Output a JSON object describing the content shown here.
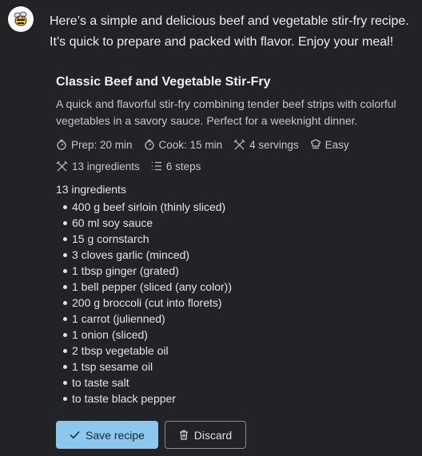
{
  "message": {
    "intro": "Here’s a simple and delicious beef and vegetable stir-fry recipe. It’s quick to prepare and packed with flavor. Enjoy your meal!"
  },
  "recipe": {
    "title": "Classic Beef and Vegetable Stir-Fry",
    "description": "A quick and flavorful stir-fry combining tender beef strips with colorful vegetables in a savory sauce. Perfect for a weeknight dinner.",
    "meta": {
      "prep": "Prep: 20 min",
      "cook": "Cook: 15 min",
      "servings": "4 servings",
      "difficulty": "Easy",
      "ingredients_count": "13 ingredients",
      "steps_count": "6 steps"
    },
    "ingredients_heading": "13 ingredients",
    "ingredients": [
      "400 g beef sirloin (thinly sliced)",
      "60 ml soy sauce",
      "15 g cornstarch",
      "3 cloves garlic (minced)",
      "1 tbsp ginger (grated)",
      "1 bell pepper (sliced (any color))",
      "200 g broccoli (cut into florets)",
      "1 carrot (julienned)",
      "1 onion (sliced)",
      "2 tbsp vegetable oil",
      "1 tsp sesame oil",
      "to taste salt",
      "to taste black pepper"
    ]
  },
  "actions": {
    "save_label": "Save recipe",
    "discard_label": "Discard"
  },
  "icons": {
    "avatar": "bee-icon",
    "prep": "timer-icon",
    "cook": "timer-icon",
    "servings": "utensils-icon",
    "difficulty": "chef-hat-icon",
    "ingredients": "utensils-icon",
    "steps": "list-icon",
    "save": "check-icon",
    "discard": "trash-icon"
  },
  "colors": {
    "background": "#212327",
    "save_button": "#8cc8ee",
    "text": "#e8e8ea",
    "muted_text": "#c4c6ca"
  }
}
